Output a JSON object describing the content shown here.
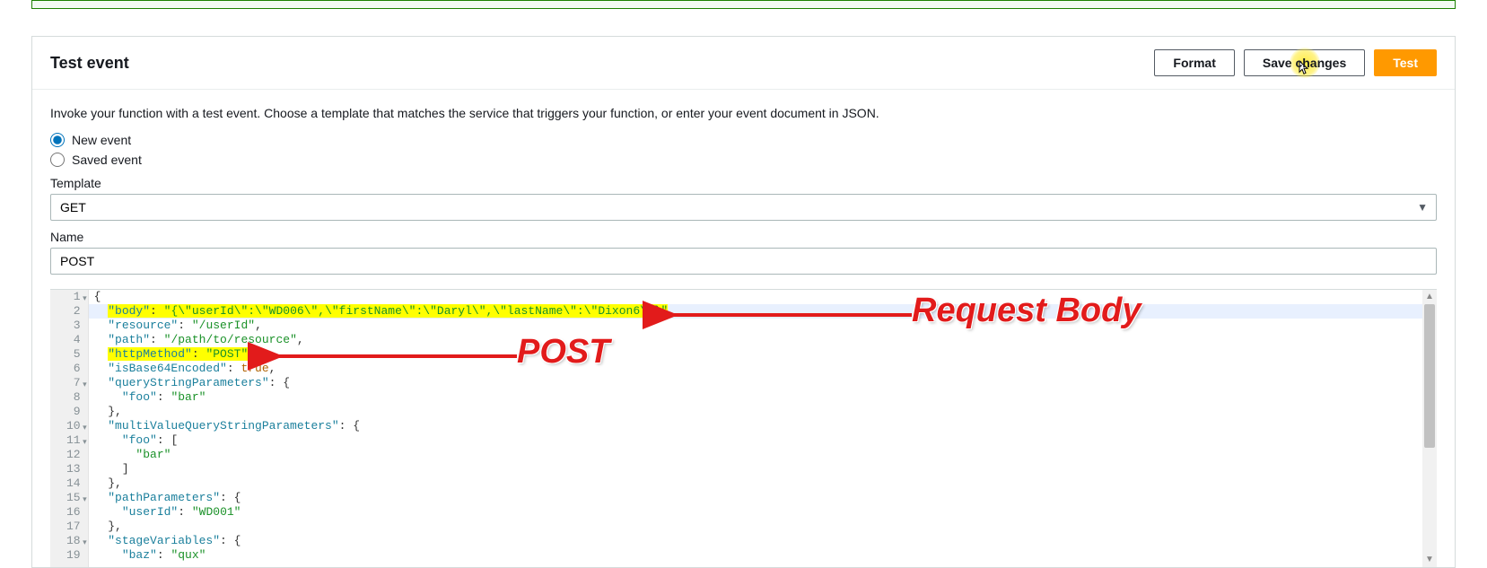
{
  "header": {
    "title": "Test event",
    "buttons": {
      "format": "Format",
      "save": "Save changes",
      "test": "Test"
    }
  },
  "body": {
    "description": "Invoke your function with a test event. Choose a template that matches the service that triggers your function, or enter your event document in JSON.",
    "radios": {
      "new_event": "New event",
      "saved_event": "Saved event"
    },
    "template_label": "Template",
    "template_value": "GET",
    "name_label": "Name",
    "name_value": "POST"
  },
  "editor": {
    "lines": [
      {
        "n": 1,
        "fold": true,
        "indent": 0,
        "tokens": [
          {
            "t": "{",
            "c": "punc"
          }
        ]
      },
      {
        "n": 2,
        "fold": false,
        "indent": 1,
        "hl_bg": true,
        "tokens": [
          {
            "t": "\"body\"",
            "c": "key",
            "hl": true
          },
          {
            "t": ": ",
            "c": "punc",
            "hl": true
          },
          {
            "t": "\"{\\\"userId\\\":\\\"WD006\\\",\\\"firstName\\\":\\\"Daryl\\\",\\\"lastName\\\":\\\"Dixon6\\\"}\"",
            "c": "str",
            "hl": true
          },
          {
            "t": ",",
            "c": "punc"
          }
        ]
      },
      {
        "n": 3,
        "fold": false,
        "indent": 1,
        "tokens": [
          {
            "t": "\"resource\"",
            "c": "key"
          },
          {
            "t": ": ",
            "c": "punc"
          },
          {
            "t": "\"/userId\"",
            "c": "str"
          },
          {
            "t": ",",
            "c": "punc"
          }
        ]
      },
      {
        "n": 4,
        "fold": false,
        "indent": 1,
        "tokens": [
          {
            "t": "\"path\"",
            "c": "key"
          },
          {
            "t": ": ",
            "c": "punc"
          },
          {
            "t": "\"/path/to/resource\"",
            "c": "str"
          },
          {
            "t": ",",
            "c": "punc"
          }
        ]
      },
      {
        "n": 5,
        "fold": false,
        "indent": 1,
        "tokens": [
          {
            "t": "\"httpMethod\"",
            "c": "key",
            "hl": true
          },
          {
            "t": ": ",
            "c": "punc",
            "hl": true
          },
          {
            "t": "\"POST\"",
            "c": "str",
            "hl": true
          },
          {
            "t": ",",
            "c": "punc",
            "hl": true
          }
        ]
      },
      {
        "n": 6,
        "fold": false,
        "indent": 1,
        "tokens": [
          {
            "t": "\"isBase64Encoded\"",
            "c": "key"
          },
          {
            "t": ": ",
            "c": "punc"
          },
          {
            "t": "true",
            "c": "kw"
          },
          {
            "t": ",",
            "c": "punc"
          }
        ]
      },
      {
        "n": 7,
        "fold": true,
        "indent": 1,
        "tokens": [
          {
            "t": "\"queryStringParameters\"",
            "c": "key"
          },
          {
            "t": ": {",
            "c": "punc"
          }
        ]
      },
      {
        "n": 8,
        "fold": false,
        "indent": 2,
        "tokens": [
          {
            "t": "\"foo\"",
            "c": "key"
          },
          {
            "t": ": ",
            "c": "punc"
          },
          {
            "t": "\"bar\"",
            "c": "str"
          }
        ]
      },
      {
        "n": 9,
        "fold": false,
        "indent": 1,
        "tokens": [
          {
            "t": "},",
            "c": "punc"
          }
        ]
      },
      {
        "n": 10,
        "fold": true,
        "indent": 1,
        "tokens": [
          {
            "t": "\"multiValueQueryStringParameters\"",
            "c": "key"
          },
          {
            "t": ": {",
            "c": "punc"
          }
        ]
      },
      {
        "n": 11,
        "fold": true,
        "indent": 2,
        "tokens": [
          {
            "t": "\"foo\"",
            "c": "key"
          },
          {
            "t": ": [",
            "c": "punc"
          }
        ]
      },
      {
        "n": 12,
        "fold": false,
        "indent": 3,
        "tokens": [
          {
            "t": "\"bar\"",
            "c": "str"
          }
        ]
      },
      {
        "n": 13,
        "fold": false,
        "indent": 2,
        "tokens": [
          {
            "t": "]",
            "c": "punc"
          }
        ]
      },
      {
        "n": 14,
        "fold": false,
        "indent": 1,
        "tokens": [
          {
            "t": "},",
            "c": "punc"
          }
        ]
      },
      {
        "n": 15,
        "fold": true,
        "indent": 1,
        "tokens": [
          {
            "t": "\"pathParameters\"",
            "c": "key"
          },
          {
            "t": ": {",
            "c": "punc"
          }
        ]
      },
      {
        "n": 16,
        "fold": false,
        "indent": 2,
        "tokens": [
          {
            "t": "\"userId\"",
            "c": "key"
          },
          {
            "t": ": ",
            "c": "punc"
          },
          {
            "t": "\"WD001\"",
            "c": "str"
          }
        ]
      },
      {
        "n": 17,
        "fold": false,
        "indent": 1,
        "tokens": [
          {
            "t": "},",
            "c": "punc"
          }
        ]
      },
      {
        "n": 18,
        "fold": true,
        "indent": 1,
        "tokens": [
          {
            "t": "\"stageVariables\"",
            "c": "key"
          },
          {
            "t": ": {",
            "c": "punc"
          }
        ]
      },
      {
        "n": 19,
        "fold": false,
        "indent": 2,
        "tokens": [
          {
            "t": "\"baz\"",
            "c": "key"
          },
          {
            "t": ": ",
            "c": "punc"
          },
          {
            "t": "\"qux\"",
            "c": "str"
          }
        ]
      }
    ]
  },
  "annotations": {
    "request_body": "Request Body",
    "post": "POST"
  }
}
